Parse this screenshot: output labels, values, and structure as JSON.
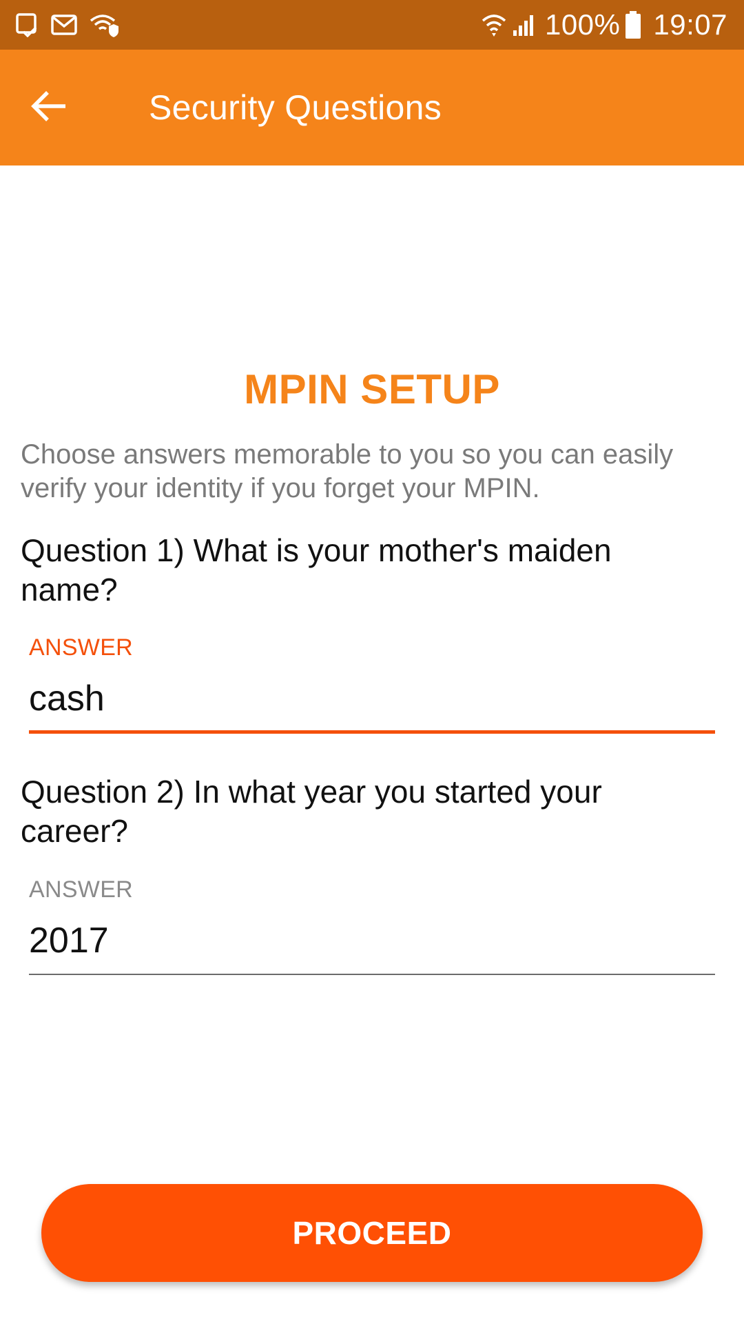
{
  "status_bar": {
    "left_icons": [
      "tablet-check-icon",
      "gmail-icon",
      "wifi-shield-icon"
    ],
    "right_icons": [
      "wifi-icon",
      "signal-icon"
    ],
    "battery_text": "100%",
    "time": "19:07"
  },
  "app_bar": {
    "back_icon": "arrow-left-icon",
    "title": "Security Questions"
  },
  "main": {
    "section_title": "MPIN SETUP",
    "intro": "Choose answers memorable to you so you can easily verify your identity if you forget your MPIN.",
    "questions": [
      {
        "text": "Question 1) What is your mother's maiden name?",
        "answer_label": "ANSWER",
        "answer_value": "cash"
      },
      {
        "text": "Question 2) In what year you started your career?",
        "answer_label": "ANSWER",
        "answer_value": "2017"
      }
    ],
    "proceed_label": "PROCEED"
  },
  "colors": {
    "status_bar": "#b8600f",
    "app_bar": "#f5841a",
    "accent": "#f4500b",
    "button": "#ff5004"
  }
}
